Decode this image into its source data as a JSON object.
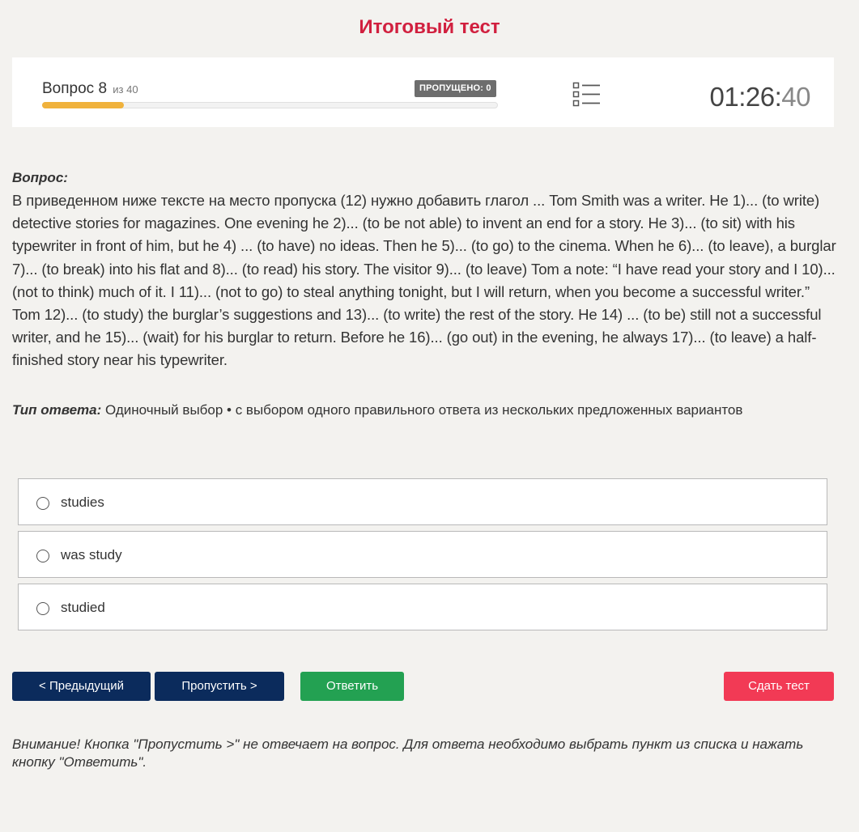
{
  "page": {
    "title": "Итоговый тест"
  },
  "header": {
    "question_prefix": "Вопрос 8",
    "question_of": "из 40",
    "progress_fraction": 0.18,
    "skipped_label": "ПРОПУЩЕНО: 0",
    "list_icon": "list-icon",
    "timer_main": "01:26:",
    "timer_seconds": "40"
  },
  "question": {
    "label": "Вопрос:",
    "text": "В приведенном ниже тексте на место пропуска (12) нужно добавить глагол ... Tom Smith was a writer. He 1)... (to write) detective stories for magazines. One evening he 2)... (to be not able) to invent an end for a story. He 3)... (to sit) with his typewriter in front of him, but he 4) ... (to have) no ideas. Then he 5)... (to go) to the cinema. When he 6)... (to leave), a burglar 7)... (to break) into his flat and 8)... (to read) his story. The visitor 9)... (to leave) Tom a note: “I have read your story and I 10)... (not to think) much of it. I 11)... (not to go) to steal anything tonight, but I will return, when you become a successful writer.” Tom 12)... (to study) the burglar’s suggestions and 13)... (to write) the rest of the story. He 14) ... (to be) still not a successful writer, and he 15)... (wait) for his burglar to return. Before he 16)... (go out) in the evening, he always 17)... (to leave) a half-finished story near his typewriter.",
    "answer_type_label": "Тип ответа:",
    "answer_type_value": " Одиночный выбор • с выбором одного правильного ответа из нескольких предложенных вариантов"
  },
  "options": [
    {
      "label": "studies"
    },
    {
      "label": "was study"
    },
    {
      "label": "studied"
    }
  ],
  "buttons": {
    "prev": "< Предыдущий",
    "skip": "Пропустить >",
    "answer": "Ответить",
    "submit": "Сдать тест"
  },
  "notice": "Внимание! Кнопка \"Пропустить >\" не отвечает на вопрос. Для ответа необходимо выбрать пункт из списка и нажать кнопку \"Ответить\".",
  "colors": {
    "title": "#d1203f",
    "progress": "#f0b23c",
    "primary": "#0b2b5c",
    "answer": "#23a152",
    "submit": "#f23a55"
  }
}
